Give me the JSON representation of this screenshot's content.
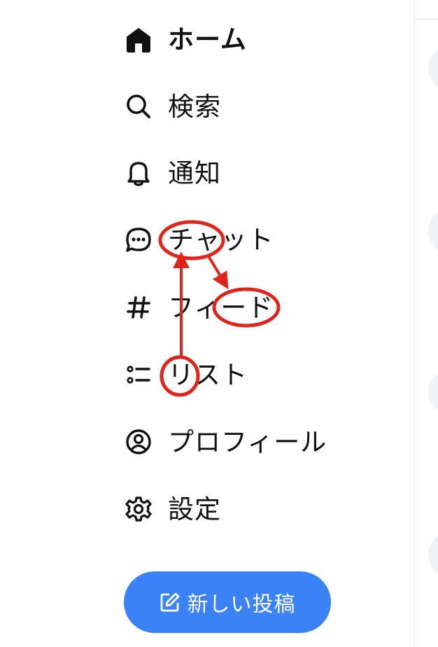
{
  "nav": {
    "items": [
      {
        "id": "home",
        "label": "ホーム",
        "icon": "home-icon",
        "active": true
      },
      {
        "id": "search",
        "label": "検索",
        "icon": "search-icon",
        "active": false
      },
      {
        "id": "notifications",
        "label": "通知",
        "icon": "bell-icon",
        "active": false
      },
      {
        "id": "chat",
        "label": "チャット",
        "icon": "chat-bubble-icon",
        "active": false
      },
      {
        "id": "feeds",
        "label": "フィード",
        "icon": "hashtag-icon",
        "active": false
      },
      {
        "id": "lists",
        "label": "リスト",
        "icon": "list-icon",
        "active": false
      },
      {
        "id": "profile",
        "label": "プロフィール",
        "icon": "profile-icon",
        "active": false
      },
      {
        "id": "settings",
        "label": "設定",
        "icon": "gear-icon",
        "active": false
      }
    ]
  },
  "post_button": {
    "label": "新しい投稿",
    "icon": "edit-icon",
    "color": "#3b82f6"
  },
  "annotations": {
    "color": "#e0241b",
    "marks": [
      {
        "type": "circle",
        "target": "チャ"
      },
      {
        "type": "circle",
        "target": "ード"
      },
      {
        "type": "circle",
        "target": "リ"
      },
      {
        "type": "arrow",
        "from": "リ",
        "to": "チャ"
      },
      {
        "type": "arrow",
        "from": "ャ",
        "to": "ード"
      }
    ]
  },
  "colors": {
    "text": "#111111",
    "divider": "#e1e4e8",
    "annotation": "#e0241b"
  }
}
